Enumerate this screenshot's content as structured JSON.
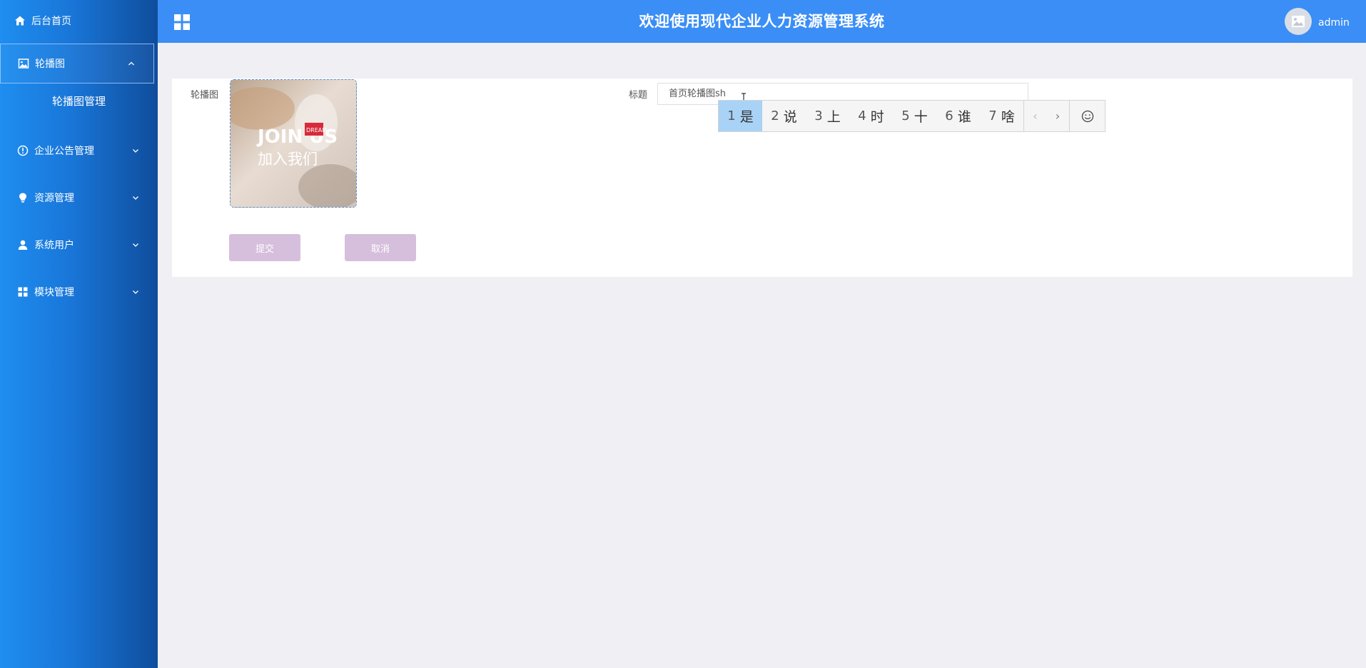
{
  "sidebar": {
    "home": "后台首页",
    "carousel": "轮播图",
    "carousel_sub": "轮播图管理",
    "notice": "企业公告管理",
    "resource": "资源管理",
    "users": "系统用户",
    "modules": "模块管理"
  },
  "header": {
    "title": "欢迎使用现代企业人力资源管理系统",
    "username": "admin"
  },
  "form": {
    "carousel_label": "轮播图",
    "title_label": "标题",
    "title_value": "首页轮播图sh",
    "submit_label": "提交",
    "cancel_label": "取消"
  },
  "image_text": {
    "line1": "JOIN US",
    "line2": "加入我们",
    "badge": "DREAM"
  },
  "ime": {
    "candidates": [
      {
        "num": "1",
        "char": "是"
      },
      {
        "num": "2",
        "char": "说"
      },
      {
        "num": "3",
        "char": "上"
      },
      {
        "num": "4",
        "char": "时"
      },
      {
        "num": "5",
        "char": "十"
      },
      {
        "num": "6",
        "char": "谁"
      },
      {
        "num": "7",
        "char": "啥"
      }
    ],
    "prev": "‹",
    "next": "›",
    "selected_index": 1
  },
  "colors": {
    "sidebar_start": "#1e8ef0",
    "sidebar_end": "#0f4d9c",
    "header": "#3a8ef6",
    "button": "#d6bfdc",
    "ime_selected": "#a9d2f7"
  }
}
